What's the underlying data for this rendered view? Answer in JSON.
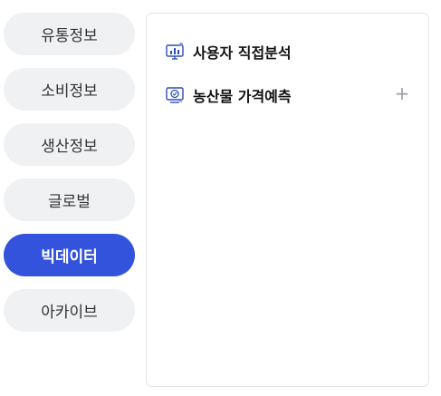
{
  "categories": [
    {
      "label": "유통정보",
      "active": false
    },
    {
      "label": "소비정보",
      "active": false
    },
    {
      "label": "생산정보",
      "active": false
    },
    {
      "label": "글로벌",
      "active": false
    },
    {
      "label": "빅데이터",
      "active": true
    },
    {
      "label": "아카이브",
      "active": false
    }
  ],
  "panel": {
    "items": [
      {
        "label": "사용자 직접분석",
        "icon": "monitor-analysis-icon",
        "expandable": false
      },
      {
        "label": "농산물 가격예측",
        "icon": "price-forecast-icon",
        "expandable": true,
        "expand_symbol": "+"
      }
    ]
  },
  "colors": {
    "active_bg": "#3353dc",
    "pill_bg": "#f0f1f3",
    "icon_blue": "#2d4fb5"
  }
}
